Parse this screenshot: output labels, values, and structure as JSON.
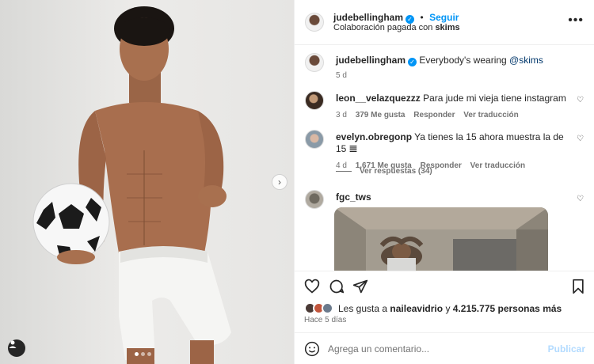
{
  "post": {
    "author": "judebellingham",
    "follow_label": "Seguir",
    "subline_prefix": "Colaboración pagada con",
    "subline_partner": "skims",
    "caption": "Everybody's wearing",
    "caption_mention": "@skims",
    "caption_time": "5 d"
  },
  "comments": [
    {
      "user": "leon__velazquezzz",
      "text": "Para jude mi vieja tiene instagram",
      "time": "3 d",
      "likes": "379 Me gusta",
      "reply": "Responder",
      "translate": "Ver traducción"
    },
    {
      "user": "evelyn.obregonp",
      "text": "Ya tienes la 15 ahora muestra la de 15 𝌆",
      "time": "4 d",
      "likes": "1,671 Me gusta",
      "reply": "Responder",
      "translate": "Ver traducción"
    },
    {
      "user": "fgc_tws",
      "text": ""
    }
  ],
  "view_replies": "Ver respuestas (34)",
  "likes_line": {
    "prefix": "Les gusta a",
    "user": "naileavidrio",
    "middle": "y",
    "count": "4.215.775 personas más"
  },
  "time_ago": "Hace 5 días",
  "add_comment": {
    "placeholder": "Agrega un comentario...",
    "post_label": "Publicar"
  },
  "colors": {
    "accent": "#0095f6",
    "text": "#262626",
    "secondary": "#737373"
  },
  "carousel": {
    "total": 3,
    "active": 1
  }
}
